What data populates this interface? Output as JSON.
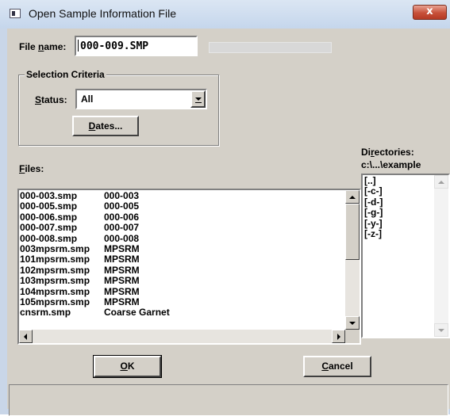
{
  "window": {
    "title": "Open Sample Information File",
    "close_glyph": "x"
  },
  "file_name": {
    "label_prefix": "File ",
    "label_accel": "n",
    "label_suffix": "ame:",
    "value": "000-009.SMP"
  },
  "selection_criteria": {
    "title": "Selection Criteria",
    "status_label_prefix": "",
    "status_label_accel": "S",
    "status_label_suffix": "tatus:",
    "status_value": "All",
    "dates_button_accel": "D",
    "dates_button_suffix": "ates..."
  },
  "directories": {
    "label_prefix": "Di",
    "label_accel": "r",
    "label_suffix": "ectories:",
    "current_path": "c:\\...\\example",
    "items": [
      "[..]",
      "[-c-]",
      "[-d-]",
      "[-g-]",
      "[-y-]",
      "[-z-]"
    ]
  },
  "files": {
    "label_accel": "F",
    "label_suffix": "iles:",
    "rows": [
      {
        "file": "000-003.smp",
        "desc": "000-003"
      },
      {
        "file": "000-005.smp",
        "desc": "000-005"
      },
      {
        "file": "000-006.smp",
        "desc": "000-006"
      },
      {
        "file": "000-007.smp",
        "desc": "000-007"
      },
      {
        "file": "000-008.smp",
        "desc": "000-008"
      },
      {
        "file": "003mpsrm.smp",
        "desc": "MPSRM"
      },
      {
        "file": "101mpsrm.smp",
        "desc": "MPSRM"
      },
      {
        "file": "102mpsrm.smp",
        "desc": "MPSRM"
      },
      {
        "file": "103mpsrm.smp",
        "desc": "MPSRM"
      },
      {
        "file": "104mpsrm.smp",
        "desc": "MPSRM"
      },
      {
        "file": "105mpsrm.smp",
        "desc": "MPSRM"
      },
      {
        "file": "cnsrm.smp",
        "desc": "Coarse Garnet"
      }
    ]
  },
  "buttons": {
    "ok_accel": "O",
    "ok_suffix": "K",
    "cancel_accel": "C",
    "cancel_suffix": "ancel"
  },
  "icons": {
    "window_icon": "app-window-icon",
    "dropdown": "chevron-down-icon"
  },
  "colors": {
    "face": "#d4d0c8",
    "title_bar": "#c9d6e8",
    "close_red": "#c75039"
  }
}
